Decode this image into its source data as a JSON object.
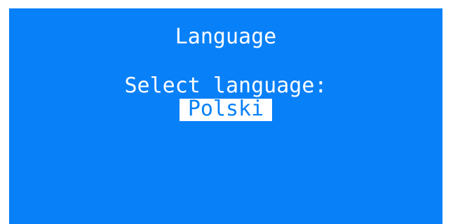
{
  "screen": {
    "title": "Language",
    "prompt": "Select language:",
    "selected_option": "Polski"
  },
  "colors": {
    "background": "#0880f8",
    "text": "#ffffff",
    "highlight_background": "#ffffff",
    "highlight_text": "#0880f8"
  }
}
